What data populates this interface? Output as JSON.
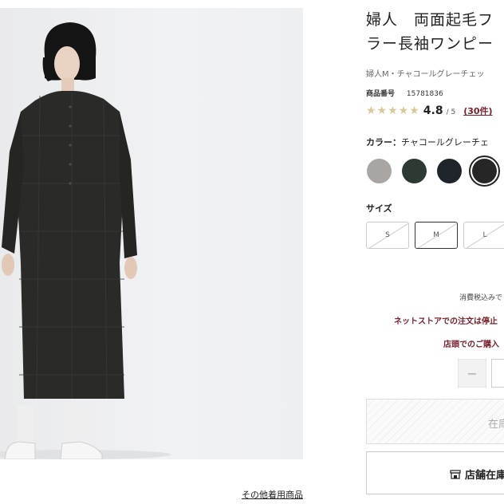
{
  "product": {
    "title_line1": "婦人　両面起毛フ",
    "title_line2": "ラー長袖ワンピー",
    "subtitle": "婦人M・チャコールグレーチェッ",
    "code_label": "商品番号",
    "code": "15781836",
    "rating": {
      "stars": "★★★★★",
      "score": "4.8",
      "outof": "/ 5",
      "count": "(30件)"
    },
    "color_label": "カラー：",
    "color_value": "チャコールグレーチェ",
    "colors": [
      {
        "name": "grey",
        "hex": "#a8a5a2"
      },
      {
        "name": "dark-green",
        "hex": "#2c3a33"
      },
      {
        "name": "navy",
        "hex": "#1f242b"
      },
      {
        "name": "charcoal-check",
        "hex": "#262626",
        "selected": true
      }
    ],
    "size_label": "サイズ",
    "sizes": [
      "S",
      "M",
      "L"
    ],
    "selected_size": "M",
    "tax_note": "消費税込みで",
    "notice1": "ネットストアでの注文は停止",
    "notice2": "店頭でのご購入",
    "qty_minus": "−",
    "stock_button": "在庫",
    "store_button": "店舗在庫"
  },
  "photo": {
    "other_items_link": "その他着用商品"
  }
}
